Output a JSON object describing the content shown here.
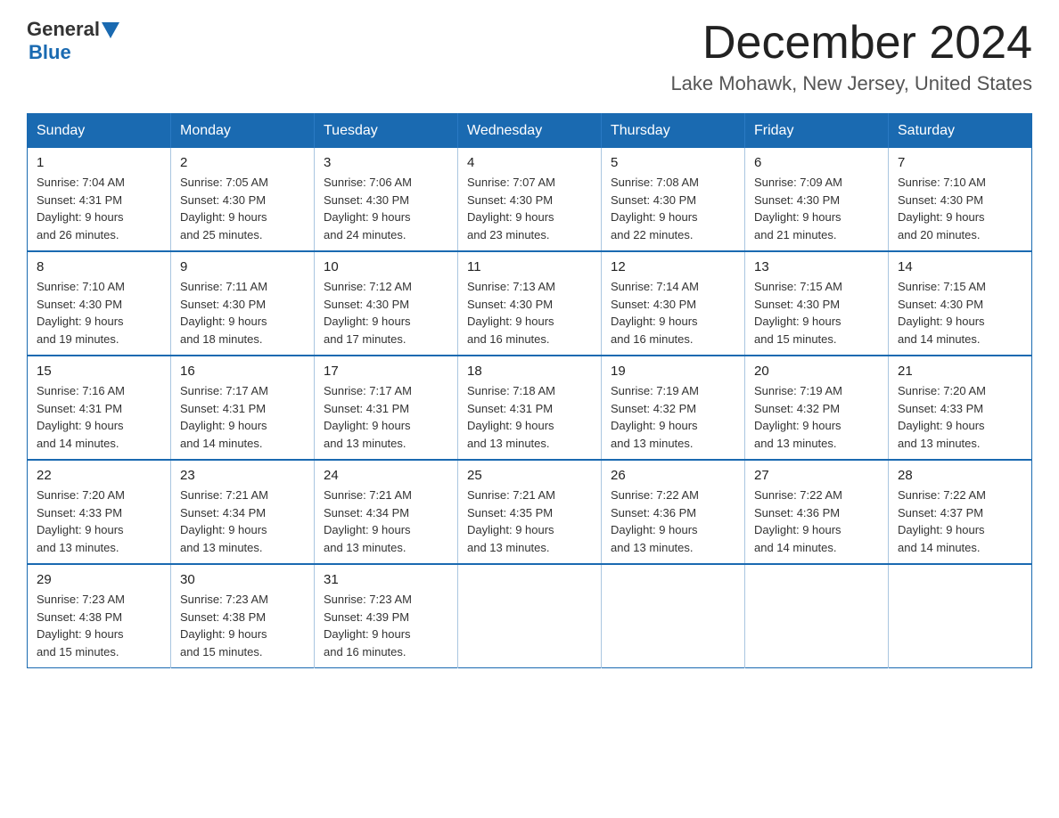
{
  "logo": {
    "general": "General",
    "blue": "Blue"
  },
  "title": "December 2024",
  "location": "Lake Mohawk, New Jersey, United States",
  "days_of_week": [
    "Sunday",
    "Monday",
    "Tuesday",
    "Wednesday",
    "Thursday",
    "Friday",
    "Saturday"
  ],
  "weeks": [
    [
      {
        "day": "1",
        "sunrise": "7:04 AM",
        "sunset": "4:31 PM",
        "daylight": "9 hours and 26 minutes."
      },
      {
        "day": "2",
        "sunrise": "7:05 AM",
        "sunset": "4:30 PM",
        "daylight": "9 hours and 25 minutes."
      },
      {
        "day": "3",
        "sunrise": "7:06 AM",
        "sunset": "4:30 PM",
        "daylight": "9 hours and 24 minutes."
      },
      {
        "day": "4",
        "sunrise": "7:07 AM",
        "sunset": "4:30 PM",
        "daylight": "9 hours and 23 minutes."
      },
      {
        "day": "5",
        "sunrise": "7:08 AM",
        "sunset": "4:30 PM",
        "daylight": "9 hours and 22 minutes."
      },
      {
        "day": "6",
        "sunrise": "7:09 AM",
        "sunset": "4:30 PM",
        "daylight": "9 hours and 21 minutes."
      },
      {
        "day": "7",
        "sunrise": "7:10 AM",
        "sunset": "4:30 PM",
        "daylight": "9 hours and 20 minutes."
      }
    ],
    [
      {
        "day": "8",
        "sunrise": "7:10 AM",
        "sunset": "4:30 PM",
        "daylight": "9 hours and 19 minutes."
      },
      {
        "day": "9",
        "sunrise": "7:11 AM",
        "sunset": "4:30 PM",
        "daylight": "9 hours and 18 minutes."
      },
      {
        "day": "10",
        "sunrise": "7:12 AM",
        "sunset": "4:30 PM",
        "daylight": "9 hours and 17 minutes."
      },
      {
        "day": "11",
        "sunrise": "7:13 AM",
        "sunset": "4:30 PM",
        "daylight": "9 hours and 16 minutes."
      },
      {
        "day": "12",
        "sunrise": "7:14 AM",
        "sunset": "4:30 PM",
        "daylight": "9 hours and 16 minutes."
      },
      {
        "day": "13",
        "sunrise": "7:15 AM",
        "sunset": "4:30 PM",
        "daylight": "9 hours and 15 minutes."
      },
      {
        "day": "14",
        "sunrise": "7:15 AM",
        "sunset": "4:30 PM",
        "daylight": "9 hours and 14 minutes."
      }
    ],
    [
      {
        "day": "15",
        "sunrise": "7:16 AM",
        "sunset": "4:31 PM",
        "daylight": "9 hours and 14 minutes."
      },
      {
        "day": "16",
        "sunrise": "7:17 AM",
        "sunset": "4:31 PM",
        "daylight": "9 hours and 14 minutes."
      },
      {
        "day": "17",
        "sunrise": "7:17 AM",
        "sunset": "4:31 PM",
        "daylight": "9 hours and 13 minutes."
      },
      {
        "day": "18",
        "sunrise": "7:18 AM",
        "sunset": "4:31 PM",
        "daylight": "9 hours and 13 minutes."
      },
      {
        "day": "19",
        "sunrise": "7:19 AM",
        "sunset": "4:32 PM",
        "daylight": "9 hours and 13 minutes."
      },
      {
        "day": "20",
        "sunrise": "7:19 AM",
        "sunset": "4:32 PM",
        "daylight": "9 hours and 13 minutes."
      },
      {
        "day": "21",
        "sunrise": "7:20 AM",
        "sunset": "4:33 PM",
        "daylight": "9 hours and 13 minutes."
      }
    ],
    [
      {
        "day": "22",
        "sunrise": "7:20 AM",
        "sunset": "4:33 PM",
        "daylight": "9 hours and 13 minutes."
      },
      {
        "day": "23",
        "sunrise": "7:21 AM",
        "sunset": "4:34 PM",
        "daylight": "9 hours and 13 minutes."
      },
      {
        "day": "24",
        "sunrise": "7:21 AM",
        "sunset": "4:34 PM",
        "daylight": "9 hours and 13 minutes."
      },
      {
        "day": "25",
        "sunrise": "7:21 AM",
        "sunset": "4:35 PM",
        "daylight": "9 hours and 13 minutes."
      },
      {
        "day": "26",
        "sunrise": "7:22 AM",
        "sunset": "4:36 PM",
        "daylight": "9 hours and 13 minutes."
      },
      {
        "day": "27",
        "sunrise": "7:22 AM",
        "sunset": "4:36 PM",
        "daylight": "9 hours and 14 minutes."
      },
      {
        "day": "28",
        "sunrise": "7:22 AM",
        "sunset": "4:37 PM",
        "daylight": "9 hours and 14 minutes."
      }
    ],
    [
      {
        "day": "29",
        "sunrise": "7:23 AM",
        "sunset": "4:38 PM",
        "daylight": "9 hours and 15 minutes."
      },
      {
        "day": "30",
        "sunrise": "7:23 AM",
        "sunset": "4:38 PM",
        "daylight": "9 hours and 15 minutes."
      },
      {
        "day": "31",
        "sunrise": "7:23 AM",
        "sunset": "4:39 PM",
        "daylight": "9 hours and 16 minutes."
      },
      null,
      null,
      null,
      null
    ]
  ],
  "labels": {
    "sunrise": "Sunrise: ",
    "sunset": "Sunset: ",
    "daylight": "Daylight: "
  }
}
